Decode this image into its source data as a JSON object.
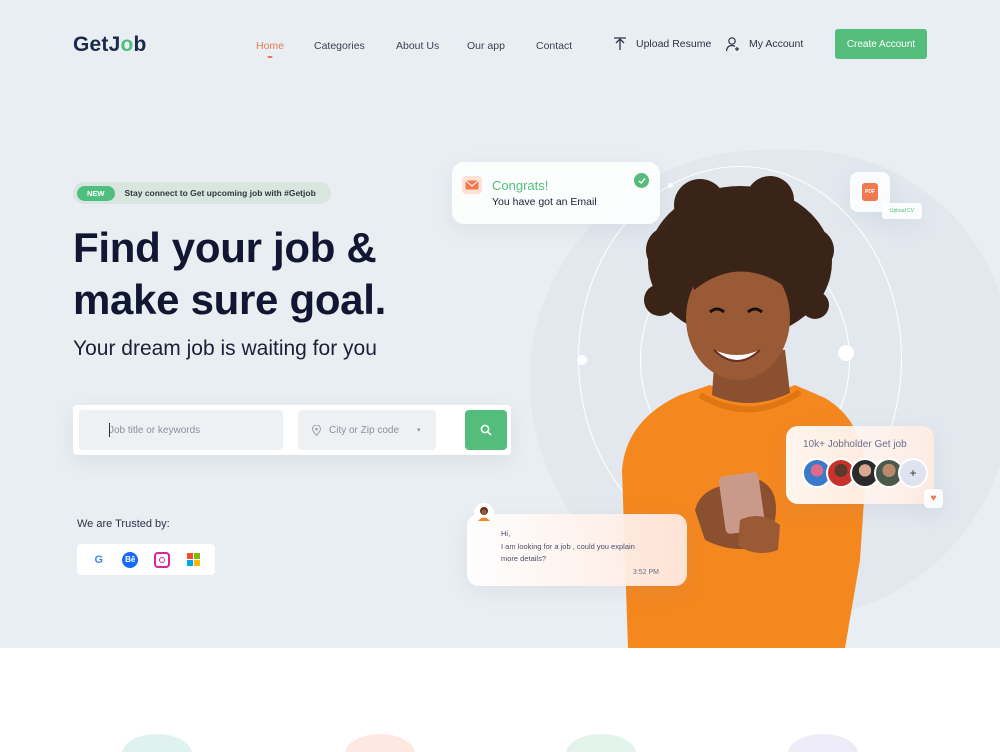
{
  "brand": {
    "logo_pre": "GetJ",
    "logo_o": "o",
    "logo_post": "b"
  },
  "nav": {
    "home": "Home",
    "categories": "Categories",
    "about": "About Us",
    "app": "Our app",
    "contact": "Contact"
  },
  "header": {
    "upload_resume": "Upload Resume",
    "my_account": "My Account",
    "create_account": "Create Account"
  },
  "hero": {
    "badge_new": "NEW",
    "badge_text": "Stay connect to Get upcoming job with #Getjob",
    "headline_line1": "Find your job &",
    "headline_line2": "make sure goal.",
    "subheadline": "Your dream job is waiting for you"
  },
  "search": {
    "keyword_placeholder": "Job title or keywords",
    "location_placeholder": "City or Zip code"
  },
  "trusted": {
    "label": "We are Trusted by:"
  },
  "cards": {
    "congrats_title": "Congrats!",
    "congrats_text": "You have got an Email",
    "pdf_label": "PDF",
    "upload_cv": "Upload CV",
    "jobholders": "10k+ Jobholder Get job",
    "plus": "+",
    "chat_line1": "Hi,",
    "chat_line2": "I am looking for a job , could you explain",
    "chat_line3": "more details?",
    "chat_time": "3:52 PM"
  },
  "colors": {
    "accent_green": "#55bd7c",
    "accent_orange": "#f07a4f",
    "hero_bg": "#e9eef2",
    "text_dark": "#111632"
  }
}
